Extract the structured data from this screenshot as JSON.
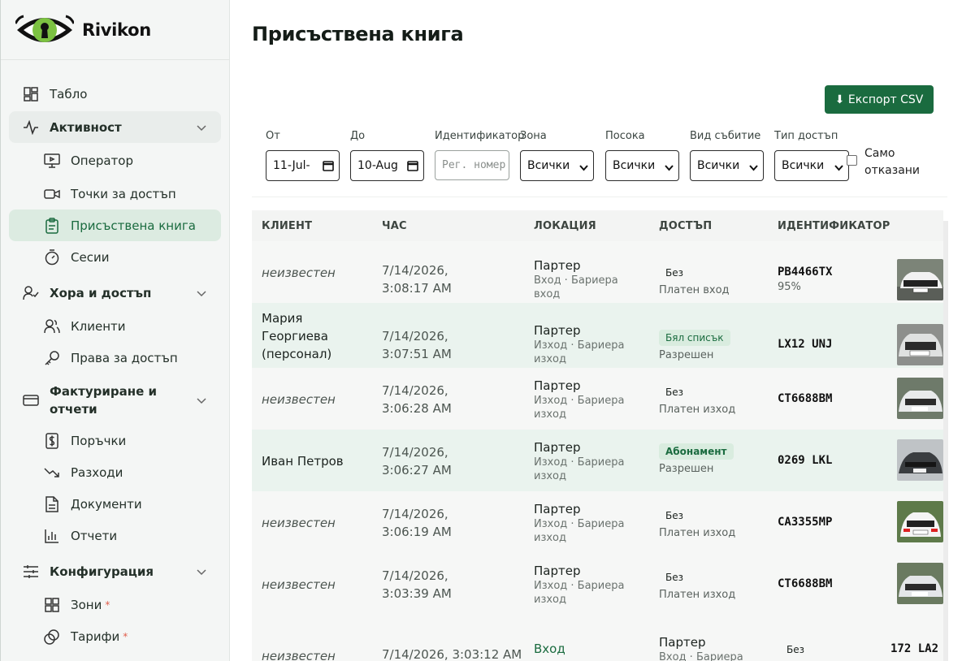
{
  "brand": {
    "name": "Rivikon"
  },
  "sidebar": {
    "items": [
      {
        "label": "Табло",
        "icon": "dashboard-icon"
      },
      {
        "label": "Активност",
        "icon": "activity-icon"
      },
      {
        "label": "Оператор",
        "icon": "monitor-icon"
      },
      {
        "label": "Точки за достъп",
        "icon": "camera-icon"
      },
      {
        "label": "Присъствена книга",
        "icon": "clipboard-icon"
      },
      {
        "label": "Сесии",
        "icon": "timer-icon"
      },
      {
        "label": "Хора и достъп",
        "icon": "user-check-icon"
      },
      {
        "label": "Клиенти",
        "icon": "users-icon"
      },
      {
        "label": "Права за достъп",
        "icon": "key-icon"
      },
      {
        "label": "Фактуриране и отчети",
        "icon": "card-icon"
      },
      {
        "label": "Поръчки",
        "icon": "dollar-icon"
      },
      {
        "label": "Разходи",
        "icon": "trend-down-icon"
      },
      {
        "label": "Документи",
        "icon": "document-icon"
      },
      {
        "label": "Отчети",
        "icon": "bar-chart-icon"
      },
      {
        "label": "Конфигурация",
        "icon": "sliders-icon"
      },
      {
        "label": "Зони",
        "icon": "grid-icon"
      },
      {
        "label": "Тарифи",
        "icon": "coins-icon"
      }
    ],
    "required_mark": "*"
  },
  "page": {
    "title": "Присъствена книга"
  },
  "toolbar": {
    "export_label": "⬇ Експорт CSV"
  },
  "filters": {
    "from_label": "От",
    "from_value": "11-Jul-",
    "to_label": "До",
    "to_value": "10-Aug",
    "id_label": "Идентификатор",
    "id_placeholder": "Рег. номер",
    "zone_label": "Зона",
    "zone_value": "Всички",
    "direction_label": "Посока",
    "direction_value": "Всички",
    "event_label": "Вид събитие",
    "event_value": "Всички",
    "access_label": "Тип достъп",
    "access_value": "Всички",
    "denied_only_label_1": "Само",
    "denied_only_label_2": "отказани"
  },
  "table": {
    "columns": [
      "КЛИЕНТ",
      "ЧАС",
      "ЛОКАЦИЯ",
      "ДОСТЪП",
      "ИДЕНТИФИКАТОР"
    ],
    "rows": [
      {
        "client": "неизвестен",
        "date": "7/14/2026,",
        "time": "3:08:17 AM",
        "loc": "Партер",
        "loc_sub_1": "Вход · Бариера",
        "loc_sub_2": "вход",
        "badge": "Без",
        "access": "Платен вход",
        "plate": "PB4466TX",
        "conf": "95%"
      },
      {
        "client_1": "Мария",
        "client_2": "Георгиева",
        "client_3": "(персонал)",
        "date": "7/14/2026,",
        "time": "3:07:51 AM",
        "loc": "Партер",
        "loc_sub_1": "Изход · Бариера",
        "loc_sub_2": "изход",
        "badge": "Бял списък",
        "access": "Разрешен",
        "plate": "LX12 UNJ"
      },
      {
        "client": "неизвестен",
        "date": "7/14/2026,",
        "time": "3:06:28 AM",
        "loc": "Партер",
        "loc_sub_1": "Изход · Бариера",
        "loc_sub_2": "изход",
        "badge": "Без",
        "access": "Платен изход",
        "plate": "CT6688BM"
      },
      {
        "client": "Иван Петров",
        "date": "7/14/2026,",
        "time": "3:06:27 AM",
        "loc": "Партер",
        "loc_sub_1": "Изход · Бариера",
        "loc_sub_2": "изход",
        "badge": "Абонамент",
        "access": "Разрешен",
        "plate": "0269 LKL"
      },
      {
        "client": "неизвестен",
        "date": "7/14/2026,",
        "time": "3:06:19 AM",
        "loc": "Партер",
        "loc_sub_1": "Изход · Бариера",
        "loc_sub_2": "изход",
        "badge": "Без",
        "access": "Платен изход",
        "plate": "CA3355MP"
      },
      {
        "client": "неизвестен",
        "date": "7/14/2026,",
        "time": "3:03:39 AM",
        "loc": "Партер",
        "loc_sub_1": "Изход · Бариера",
        "loc_sub_2": "изход",
        "badge": "Без",
        "access": "Платен изход",
        "plate": "CT6688BM"
      },
      {
        "client": "неизвестен",
        "datetime": "7/14/2026, 3:03:12 AM",
        "direction": "Вход",
        "loc": "Партер",
        "loc_sub_1": "Вход · Бариера",
        "badge": "Без",
        "plate": "172 LA2"
      }
    ]
  },
  "colors": {
    "accent": "#1a6b3f",
    "active_bg": "#dcebe1",
    "row_highlight": "#eaf3ee"
  }
}
